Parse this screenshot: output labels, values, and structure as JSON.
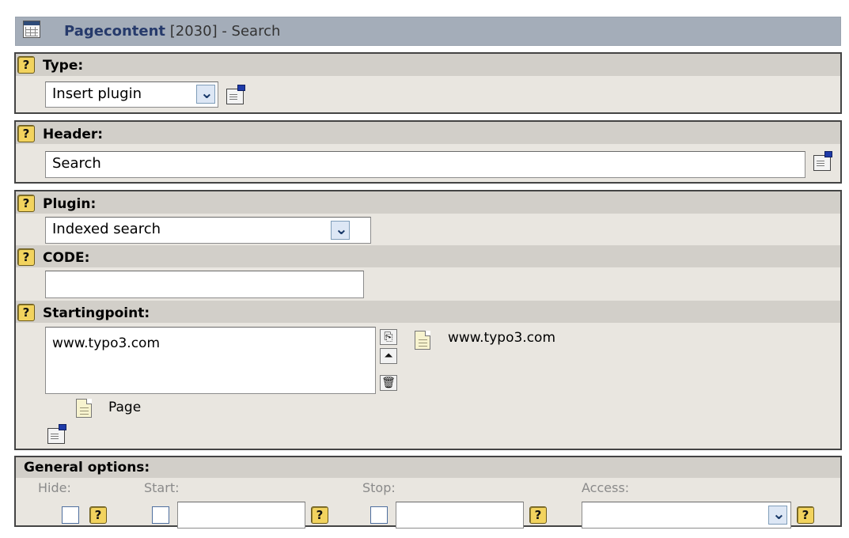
{
  "title": {
    "bold": "Pagecontent",
    "rest": " [2030] - Search"
  },
  "help_glyph": "?",
  "type": {
    "label": "Type:",
    "value": "Insert plugin"
  },
  "header": {
    "label": "Header:",
    "value": "Search"
  },
  "plugin": {
    "label": "Plugin:",
    "value": "Indexed search"
  },
  "code": {
    "label": "CODE:",
    "value": ""
  },
  "startingpoint": {
    "label": "Startingpoint:",
    "selected": "www.typo3.com",
    "record_label": "www.typo3.com",
    "page_label": "Page",
    "buttons": {
      "browse": "⎘",
      "move_top": "⏶",
      "remove": "🗑"
    }
  },
  "general": {
    "label": "General options:",
    "hide": "Hide:",
    "start": "Start:",
    "stop": "Stop:",
    "access": "Access:",
    "start_value": "",
    "stop_value": "",
    "access_value": ""
  },
  "colors": {
    "title_bar": "#a4adb9",
    "section_bg": "#e9e6e0",
    "row_head": "#d2cfc9",
    "help": "#f2d35e"
  }
}
